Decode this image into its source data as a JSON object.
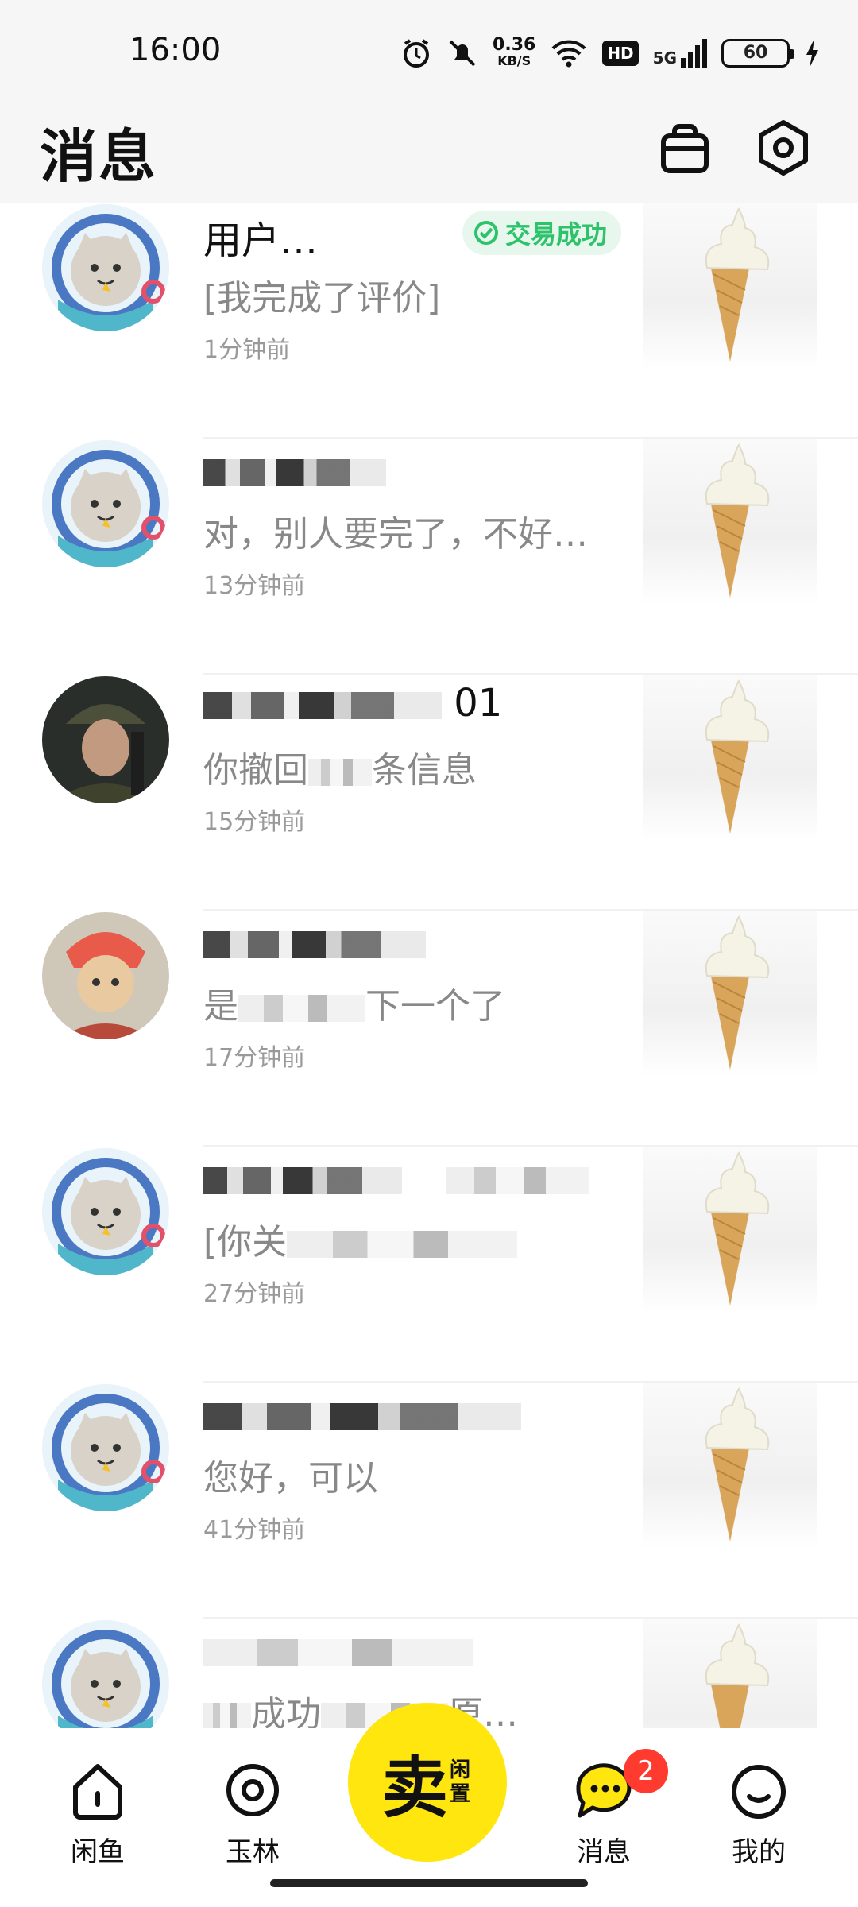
{
  "status_bar": {
    "time": "16:00",
    "net_speed_value": "0.36",
    "net_speed_unit": "KB/S",
    "hd": "HD",
    "signal": "5G",
    "battery": "60"
  },
  "header": {
    "title": "消息",
    "icons": [
      "bag-icon",
      "settings-icon"
    ]
  },
  "conversations": [
    {
      "name": "用户…",
      "badge": "交易成功",
      "preview": "[我完成了评价]",
      "time": "1分钟前"
    },
    {
      "name": "",
      "preview": "对，别人要完了，不好…",
      "time": "13分钟前"
    },
    {
      "name": "01",
      "preview_a": "你撤回",
      "preview_b": "条信息",
      "time": "15分钟前"
    },
    {
      "name": "",
      "preview_a": "是",
      "preview_b": "下一个了",
      "time": "17分钟前"
    },
    {
      "name": "",
      "preview_a": "[你关",
      "preview_b": "",
      "time": "27分钟前"
    },
    {
      "name": "",
      "preview": "您好，可以",
      "time": "41分钟前"
    },
    {
      "name": "",
      "preview_a": "成功",
      "preview_b": "原…",
      "time": ""
    }
  ],
  "bottom_nav": {
    "items": [
      {
        "label": "闲鱼",
        "icon": "home-icon"
      },
      {
        "label": "玉林",
        "icon": "location-icon"
      },
      {
        "label": "消息",
        "icon": "chat-icon",
        "count": "2"
      },
      {
        "label": "我的",
        "icon": "profile-icon"
      }
    ],
    "sell_main": "卖",
    "sell_sub": "闲置"
  },
  "colors": {
    "accent_yellow": "#ffe60f",
    "success_green": "#2ec36b",
    "badge_red": "#ff3b30"
  }
}
